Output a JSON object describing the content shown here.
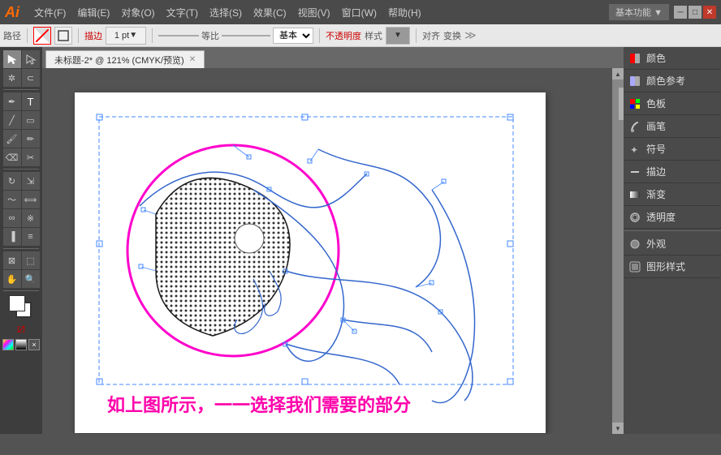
{
  "app": {
    "logo": "Ai",
    "title": "Adobe Illustrator"
  },
  "menubar": {
    "items": [
      "文件(F)",
      "编辑(E)",
      "对象(O)",
      "文字(T)",
      "选择(S)",
      "效果(C)",
      "视图(V)",
      "窗口(W)",
      "帮助(H)"
    ]
  },
  "toolbar": {
    "label": "路径",
    "stroke_label": "描边",
    "stroke_size": "1 pt",
    "ratio_label": "等比",
    "base_label": "基本",
    "opacity_label": "不透明度",
    "style_label": "样式",
    "align_label": "对齐",
    "transform_label": "变换"
  },
  "tabs": [
    {
      "label": "未标题-2* @ 121% (CMYK/预览)",
      "active": true
    }
  ],
  "workspace_btn": "基本功能 ▼",
  "caption": "如上图所示，一一选择我们需要的部分",
  "right_panel": {
    "items": [
      {
        "icon": "◨",
        "label": "颜色"
      },
      {
        "icon": "◨",
        "label": "颜色参考"
      },
      {
        "icon": "▦",
        "label": "色板"
      },
      {
        "icon": "✎",
        "label": "画笔"
      },
      {
        "icon": "✦",
        "label": "符号"
      },
      {
        "icon": "─",
        "label": "描边"
      },
      {
        "icon": "▬",
        "label": "渐变"
      },
      {
        "icon": "◎",
        "label": "透明度"
      },
      {
        "icon": "◈",
        "label": "外观"
      },
      {
        "icon": "◧",
        "label": "图形样式"
      }
    ]
  },
  "win_controls": {
    "minimize": "─",
    "maximize": "□",
    "close": "✕"
  }
}
